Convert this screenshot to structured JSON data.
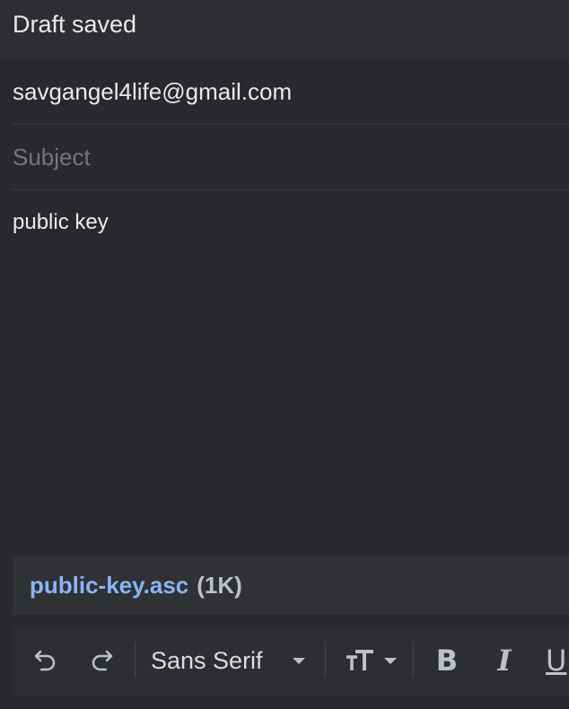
{
  "header": {
    "title": "Draft saved"
  },
  "compose": {
    "to_value": "savgangel4life@gmail.com",
    "subject_placeholder": "Subject",
    "subject_value": "",
    "body": "public key"
  },
  "attachment": {
    "name": "public-key.asc",
    "size": "(1K)"
  },
  "toolbar": {
    "undo_icon": "undo-icon",
    "redo_icon": "redo-icon",
    "font_label": "Sans Serif",
    "text_size_icon": "text-size-icon",
    "bold": "B",
    "italic": "I",
    "underline": "U"
  },
  "colors": {
    "background": "#28292c",
    "header": "#2d2e31",
    "attachment_link": "#8ab4f8",
    "text": "#e8eaed"
  }
}
